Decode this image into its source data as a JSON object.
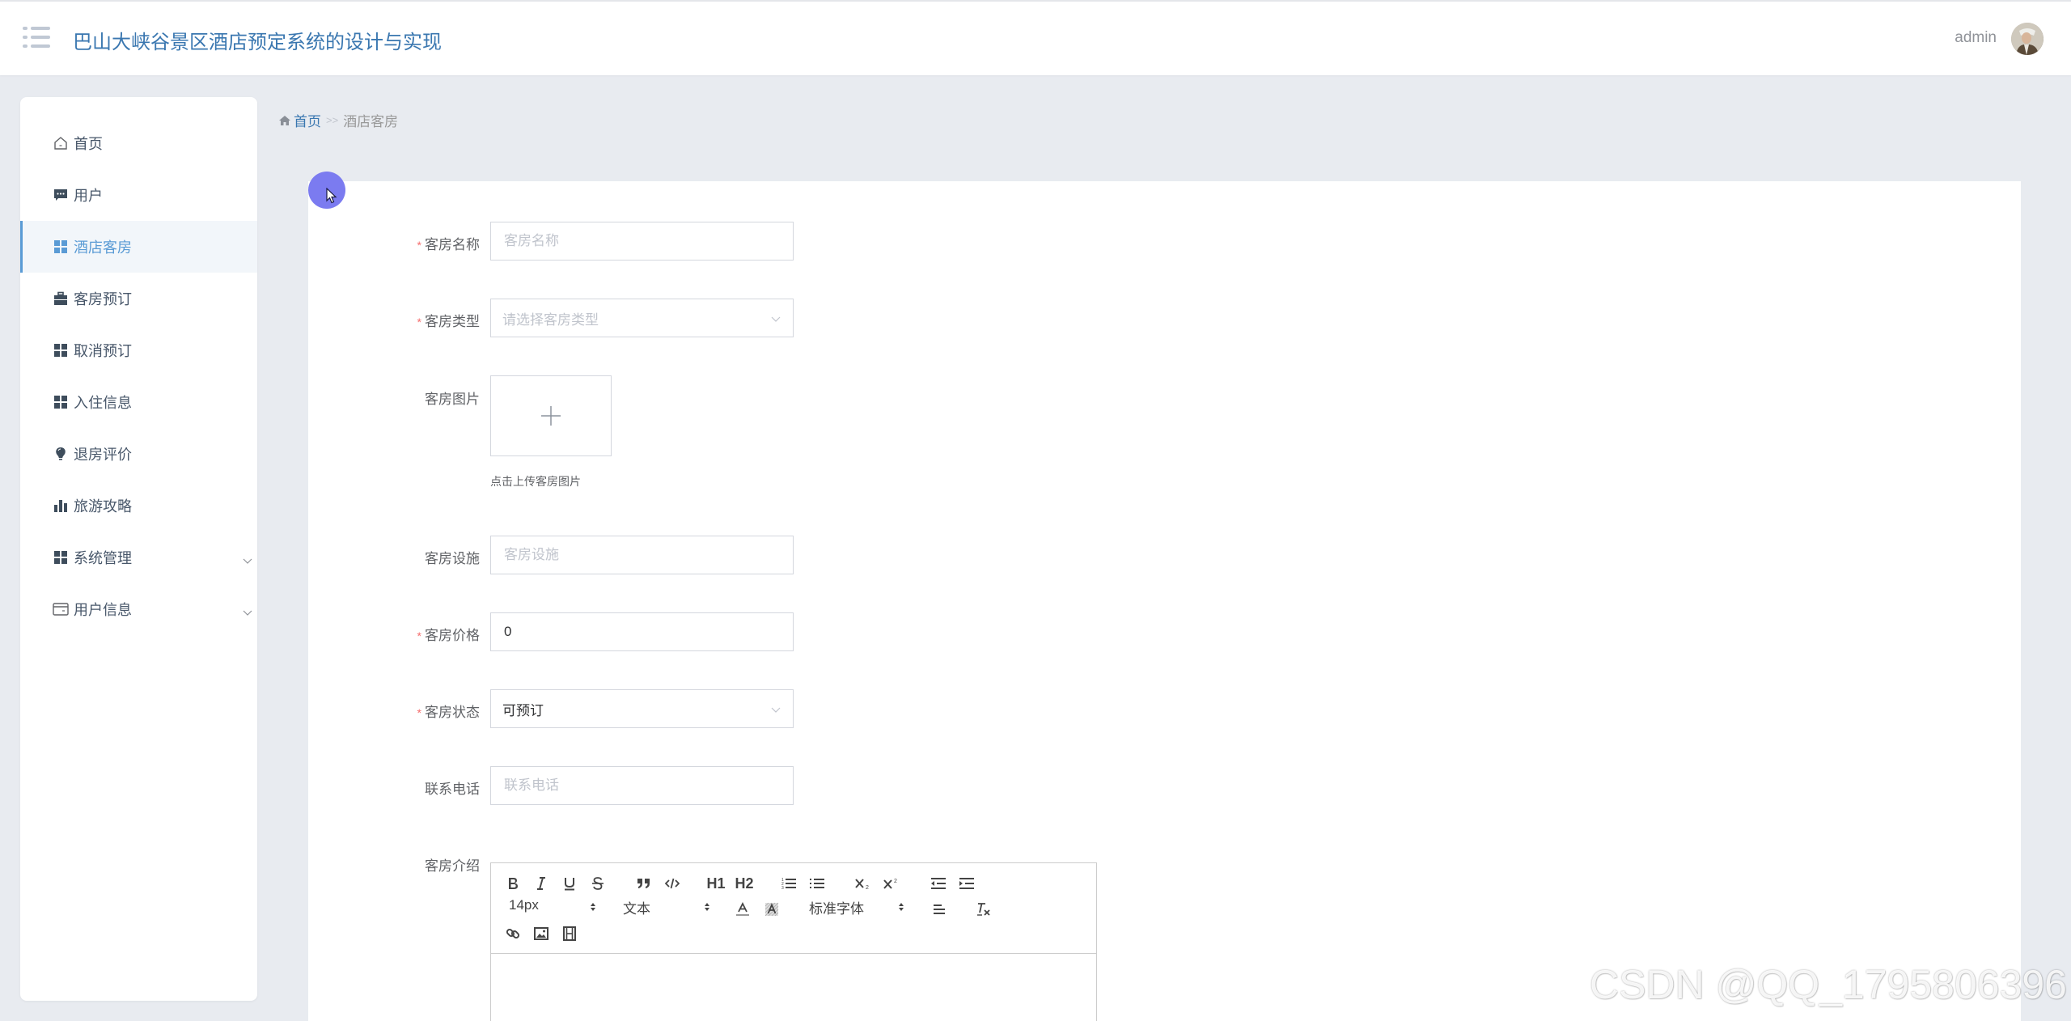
{
  "header": {
    "title": "巴山大峡谷景区酒店预定系统的设计与实现",
    "user_name": "admin",
    "menu_icon": "menu-list-icon",
    "avatar_icon": "user-avatar"
  },
  "sidebar": {
    "items": [
      {
        "label": "首页",
        "icon": "home-icon",
        "active": false
      },
      {
        "label": "用户",
        "icon": "message-icon",
        "active": false
      },
      {
        "label": "酒店客房",
        "icon": "grid-icon",
        "active": true
      },
      {
        "label": "客房预订",
        "icon": "briefcase-icon",
        "active": false
      },
      {
        "label": "取消预订",
        "icon": "grid-icon",
        "active": false
      },
      {
        "label": "入住信息",
        "icon": "grid-icon",
        "active": false
      },
      {
        "label": "退房评价",
        "icon": "lightbulb-icon",
        "active": false
      },
      {
        "label": "旅游攻略",
        "icon": "bar-chart-icon",
        "active": false
      },
      {
        "label": "系统管理",
        "icon": "grid-icon",
        "active": false,
        "expandable": true
      },
      {
        "label": "用户信息",
        "icon": "card-icon",
        "active": false,
        "expandable": true
      }
    ]
  },
  "breadcrumb": {
    "home": "首页",
    "separator": ">>",
    "current": "酒店客房"
  },
  "form": {
    "room_name": {
      "label": "客房名称",
      "required": true,
      "placeholder": "客房名称",
      "value": ""
    },
    "room_type": {
      "label": "客房类型",
      "required": true,
      "placeholder": "请选择客房类型",
      "value": ""
    },
    "room_image": {
      "label": "客房图片",
      "required": false,
      "tip": "点击上传客房图片"
    },
    "room_facilities": {
      "label": "客房设施",
      "required": false,
      "placeholder": "客房设施",
      "value": ""
    },
    "room_price": {
      "label": "客房价格",
      "required": true,
      "placeholder": "",
      "value": "0"
    },
    "room_status": {
      "label": "客房状态",
      "required": true,
      "value": "可预订"
    },
    "phone": {
      "label": "联系电话",
      "required": false,
      "placeholder": "联系电话",
      "value": ""
    },
    "intro": {
      "label": "客房介绍",
      "required": false
    }
  },
  "editor": {
    "font_size": "14px",
    "header_type": "文本",
    "font_family": "标准字体",
    "buttons": [
      "bold",
      "italic",
      "underline",
      "strike",
      "blockquote",
      "code-block",
      "h1",
      "h2",
      "ordered-list",
      "bullet-list",
      "subscript",
      "superscript",
      "outdent",
      "indent",
      "font-color",
      "background-color",
      "align",
      "clean",
      "link",
      "image",
      "video"
    ],
    "h1": "H1",
    "h2": "H2"
  },
  "colors": {
    "accent": "#3a77b0",
    "active": "#5a9bd5",
    "required": "#f56c6c",
    "background": "#e8ebf0"
  },
  "watermark": "CSDN @QQ_1795806396"
}
